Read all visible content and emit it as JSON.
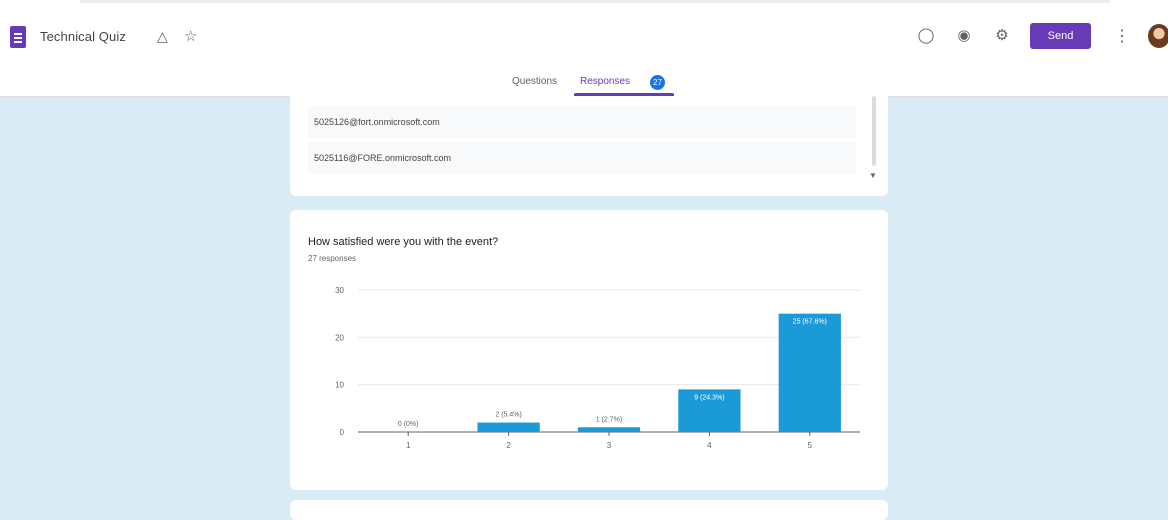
{
  "header": {
    "title": "Technical Quiz",
    "send_label": "Send",
    "icons": [
      "form-icon",
      "move-to-folder-icon",
      "star-icon",
      "palette-icon",
      "preview-eye-icon",
      "settings-gear-icon",
      "more-vert-icon"
    ]
  },
  "tabs": {
    "questions": "Questions",
    "responses": "Responses",
    "responses_count": "27"
  },
  "emails": [
    "5025126@fort.onmicrosoft.com",
    "5025116@FORE.onmicrosoft.com"
  ],
  "question": {
    "title": "How satisfied were you with the event?",
    "responses": "27 responses"
  },
  "chart_data": {
    "type": "bar",
    "categories": [
      "1",
      "2",
      "3",
      "4",
      "5"
    ],
    "values": [
      0,
      2,
      1,
      9,
      25
    ],
    "data_labels": [
      "0 (0%)",
      "2 (5.4%)",
      "1 (2.7%)",
      "9 (24.3%)",
      "25 (67.6%)"
    ],
    "ylim": [
      0,
      30
    ],
    "yticks": [
      0,
      10,
      20,
      30
    ],
    "grid": true,
    "bar_color": "#1a9bd7"
  },
  "colors": {
    "accent": "#673ab7",
    "page_bg": "#d9ecf6"
  }
}
